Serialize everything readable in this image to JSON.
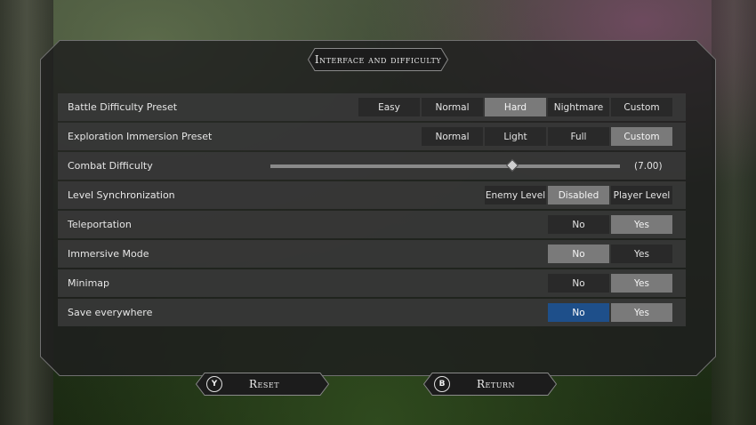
{
  "title": "Interface and difficulty",
  "rows": [
    {
      "label": "Battle Difficulty Preset",
      "options": [
        "Easy",
        "Normal",
        "Hard",
        "Nightmare",
        "Custom"
      ],
      "selected": 2
    },
    {
      "label": "Exploration Immersion Preset",
      "options": [
        "Normal",
        "Light",
        "Full",
        "Custom"
      ],
      "selected": 3
    },
    {
      "label": "Combat Difficulty",
      "slider_fraction": 0.69,
      "value_text": "(7.00)"
    },
    {
      "label": "Level Synchronization",
      "options": [
        "Enemy Level",
        "Disabled",
        "Player Level"
      ],
      "selected": 1
    },
    {
      "label": "Teleportation",
      "options": [
        "No",
        "Yes"
      ],
      "selected": 1
    },
    {
      "label": "Immersive Mode",
      "options": [
        "No",
        "Yes"
      ],
      "selected": 0
    },
    {
      "label": "Minimap",
      "options": [
        "No",
        "Yes"
      ],
      "selected": 1
    },
    {
      "label": "Save everywhere",
      "options": [
        "No",
        "Yes"
      ],
      "selected": 1,
      "focused": 0
    }
  ],
  "footer": {
    "reset": {
      "button_glyph": "Y",
      "label": "Reset"
    },
    "return": {
      "button_glyph": "B",
      "label": "Return"
    }
  },
  "colors": {
    "focus": "#1e4f8a",
    "selected": "#7a7a7a"
  }
}
